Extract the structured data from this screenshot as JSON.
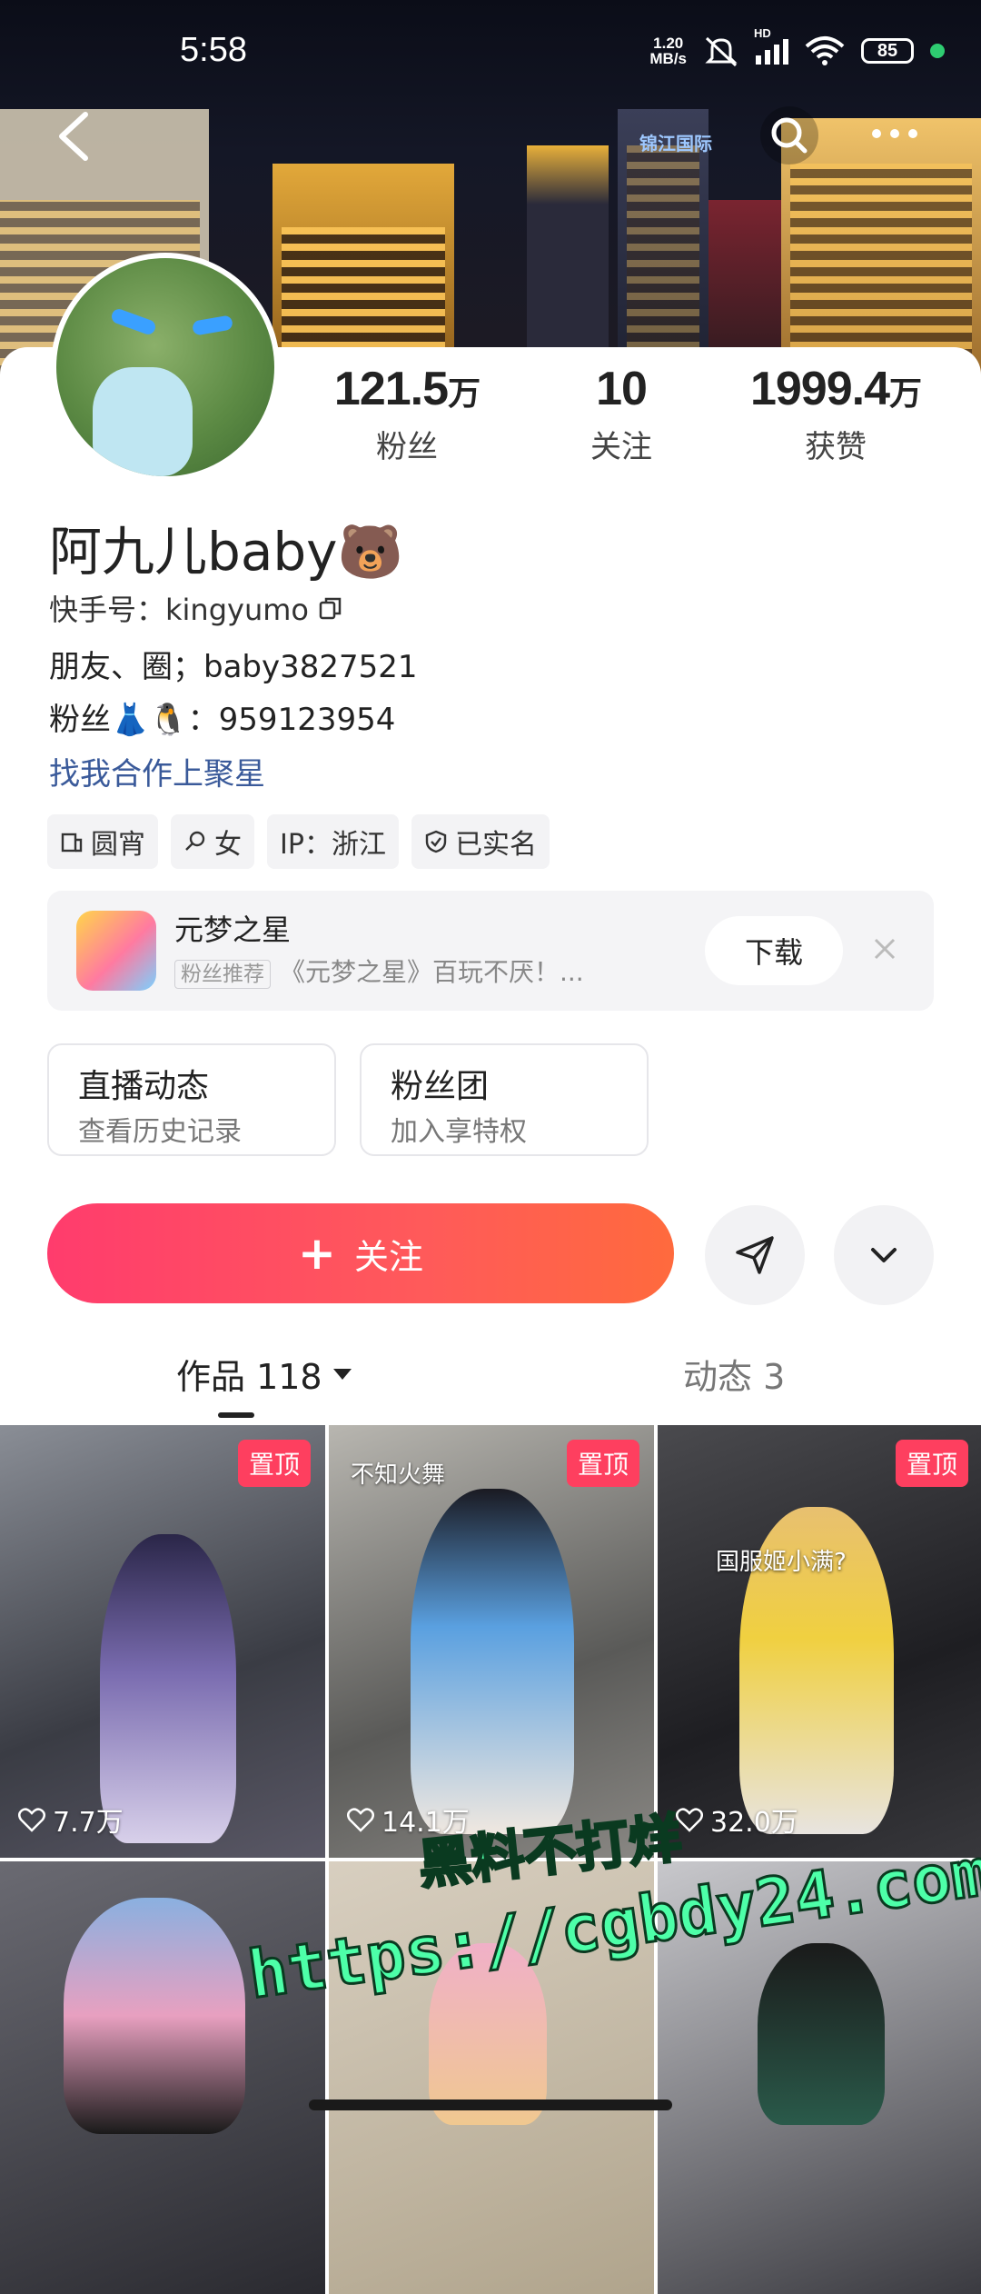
{
  "status_bar": {
    "time": "5:58",
    "net_speed_value": "1.20",
    "net_speed_unit": "MB/s",
    "hd_label": "HD",
    "battery": "85"
  },
  "header": {
    "back_icon": "chevron-left-icon",
    "search_icon": "search-icon",
    "more_icon": "more-dots-icon",
    "cover_sign_1": "锦江国际"
  },
  "profile": {
    "stats": [
      {
        "num": "121.5",
        "unit": "万",
        "label": "粉丝"
      },
      {
        "num": "10",
        "unit": "",
        "label": "关注"
      },
      {
        "num": "1999.4",
        "unit": "万",
        "label": "获赞"
      }
    ],
    "name": "阿九儿baby🐻",
    "kuaishou_id": "快手号：kingyumo",
    "bio_line1": "朋友、圈；baby3827521",
    "bio_line2": "粉丝👗🐧：959123954",
    "bio_link": "找我合作上聚星",
    "tags": [
      "圆宵",
      "女",
      "IP：浙江",
      "已实名"
    ]
  },
  "ad": {
    "title": "元梦之星",
    "badge": "粉丝推荐",
    "subtitle": "《元梦之星》百玩不厌！...",
    "download_label": "下载"
  },
  "cards": [
    {
      "title": "直播动态",
      "subtitle": "查看历史记录"
    },
    {
      "title": "粉丝团",
      "subtitle": "加入享特权"
    }
  ],
  "actions": {
    "follow_label": "关注"
  },
  "tabs": {
    "works_label": "作品 118",
    "moments_label": "动态 3"
  },
  "videos": [
    {
      "pinned": "置顶",
      "likes": "7.7万",
      "caption": ""
    },
    {
      "pinned": "置顶",
      "likes": "14.1万",
      "caption": "不知火舞"
    },
    {
      "pinned": "置顶",
      "likes": "32.0万",
      "caption": "国服姬小满?"
    },
    {
      "pinned": "",
      "likes": "",
      "caption": ""
    },
    {
      "pinned": "",
      "likes": "",
      "caption": ""
    },
    {
      "pinned": "",
      "likes": "",
      "caption": ""
    }
  ],
  "watermark": {
    "line1": "黑料不打烊",
    "line2": "https://cgbdy24.com"
  },
  "colors": {
    "accent": "#ff4a5f",
    "link": "#3a5a9a",
    "pin_badge": "#fe3f5f"
  }
}
